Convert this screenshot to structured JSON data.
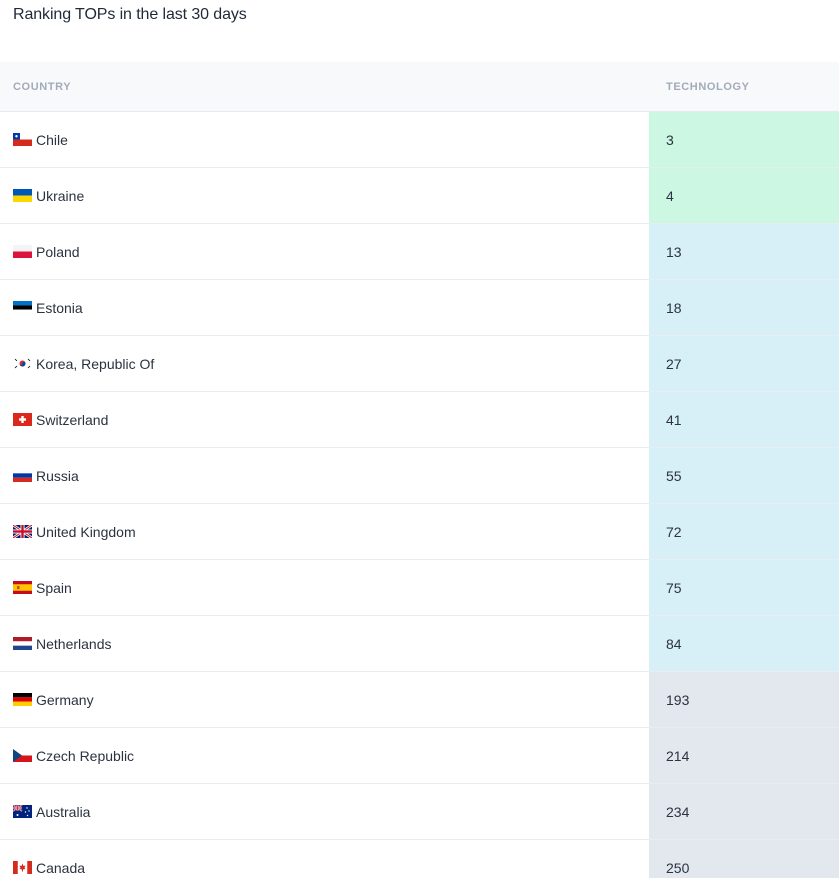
{
  "page": {
    "title": "Ranking TOPs in the last 30 days"
  },
  "table": {
    "headers": {
      "country": "COUNTRY",
      "technology": "TECHNOLOGY"
    },
    "rows": [
      {
        "country": "Chile",
        "flag": "chile-flag-icon",
        "technology": "3",
        "level": "green"
      },
      {
        "country": "Ukraine",
        "flag": "ukraine-flag-icon",
        "technology": "4",
        "level": "green"
      },
      {
        "country": "Poland",
        "flag": "poland-flag-icon",
        "technology": "13",
        "level": "blue"
      },
      {
        "country": "Estonia",
        "flag": "estonia-flag-icon",
        "technology": "18",
        "level": "blue"
      },
      {
        "country": "Korea, Republic Of",
        "flag": "korea-flag-icon",
        "technology": "27",
        "level": "blue"
      },
      {
        "country": "Switzerland",
        "flag": "switzerland-flag-icon",
        "technology": "41",
        "level": "blue"
      },
      {
        "country": "Russia",
        "flag": "russia-flag-icon",
        "technology": "55",
        "level": "blue"
      },
      {
        "country": "United Kingdom",
        "flag": "united-kingdom-flag-icon",
        "technology": "72",
        "level": "blue"
      },
      {
        "country": "Spain",
        "flag": "spain-flag-icon",
        "technology": "75",
        "level": "blue"
      },
      {
        "country": "Netherlands",
        "flag": "netherlands-flag-icon",
        "technology": "84",
        "level": "blue"
      },
      {
        "country": "Germany",
        "flag": "germany-flag-icon",
        "technology": "193",
        "level": "gray"
      },
      {
        "country": "Czech Republic",
        "flag": "czech-flag-icon",
        "technology": "214",
        "level": "gray"
      },
      {
        "country": "Australia",
        "flag": "australia-flag-icon",
        "technology": "234",
        "level": "gray"
      },
      {
        "country": "Canada",
        "flag": "canada-flag-icon",
        "technology": "250",
        "level": "gray"
      }
    ]
  },
  "colors": {
    "level_green": "#ccf7e3",
    "level_blue": "#d7eff6",
    "level_gray": "#e3e7ee",
    "header_text": "#a2abba"
  }
}
